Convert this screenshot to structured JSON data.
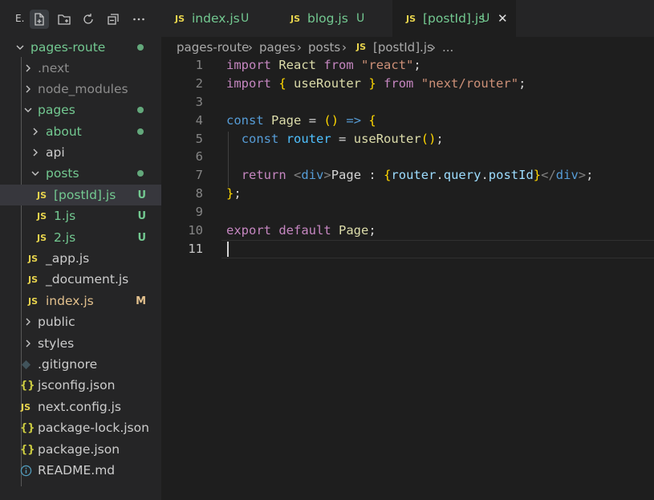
{
  "explorer": {
    "title_short": "E.",
    "toolbar": [
      "new-file-icon",
      "new-folder-icon",
      "refresh-icon",
      "collapse-all-icon",
      "more-icon"
    ],
    "root": "pages-route",
    "items": [
      {
        "label": ".next",
        "type": "folder",
        "depth": 1,
        "expanded": false
      },
      {
        "label": "node_modules",
        "type": "folder",
        "depth": 1,
        "expanded": false
      },
      {
        "label": "pages",
        "type": "folder",
        "depth": 1,
        "expanded": true
      },
      {
        "label": "about",
        "type": "folder",
        "depth": 2,
        "expanded": false
      },
      {
        "label": "api",
        "type": "folder",
        "depth": 2,
        "expanded": false
      },
      {
        "label": "posts",
        "type": "folder",
        "depth": 2,
        "expanded": true
      },
      {
        "label": "[postId].js",
        "type": "js",
        "depth": 3,
        "badge": "U"
      },
      {
        "label": "1.js",
        "type": "js",
        "depth": 3,
        "badge": "U"
      },
      {
        "label": "2.js",
        "type": "js",
        "depth": 3,
        "badge": "U"
      },
      {
        "label": "_app.js",
        "type": "js",
        "depth": 2
      },
      {
        "label": "_document.js",
        "type": "js",
        "depth": 2
      },
      {
        "label": "index.js",
        "type": "js",
        "depth": 2,
        "badge": "M"
      },
      {
        "label": "public",
        "type": "folder",
        "depth": 1,
        "expanded": false
      },
      {
        "label": "styles",
        "type": "folder",
        "depth": 1,
        "expanded": false
      },
      {
        "label": ".gitignore",
        "type": "git",
        "depth": 1
      },
      {
        "label": "jsconfig.json",
        "type": "json",
        "depth": 1
      },
      {
        "label": "next.config.js",
        "type": "js",
        "depth": 1
      },
      {
        "label": "package-lock.json",
        "type": "json",
        "depth": 1
      },
      {
        "label": "package.json",
        "type": "json",
        "depth": 1
      },
      {
        "label": "README.md",
        "type": "info",
        "depth": 1
      }
    ],
    "file_icon_js": "JS",
    "file_icon_json": "{}"
  },
  "tabs": [
    {
      "name": "index.js",
      "badge": "U",
      "active": false
    },
    {
      "name": "blog.js",
      "badge": "U",
      "active": false
    },
    {
      "name": "[postId].js",
      "badge": "U",
      "active": true
    }
  ],
  "tab_close": "✕",
  "breadcrumb": [
    "pages-route",
    "pages",
    "posts",
    "[postId].js",
    "..."
  ],
  "editor": {
    "line_numbers": [
      "1",
      "2",
      "3",
      "4",
      "5",
      "6",
      "7",
      "8",
      "9",
      "10",
      "11"
    ],
    "current_line": 11,
    "lines": [
      "import React from \"react\";",
      "import { useRouter } from \"next/router\";",
      "",
      "const Page = () => {",
      "  const router = useRouter();",
      "",
      "  return <div>Page : {router.query.postId}</div>;",
      "};",
      "",
      "export default Page;",
      ""
    ]
  },
  "colors": {
    "untracked": "#73c991",
    "modified": "#e2c08d",
    "js_icon": "#e8d44d",
    "json_icon": "#cbcb41",
    "accent_keyword": "#c586c0"
  }
}
